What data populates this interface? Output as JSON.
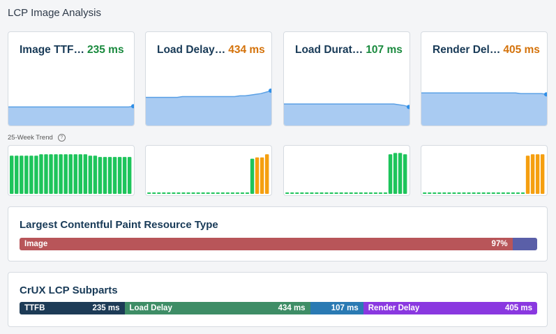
{
  "page": {
    "title": "LCP Image Analysis"
  },
  "metrics": [
    {
      "name": "Image TTF…",
      "value": "235 ms",
      "status": "good",
      "trend": [
        26,
        26,
        26,
        26,
        26,
        26,
        26,
        26,
        26,
        26,
        26,
        26,
        26,
        26,
        26,
        26,
        26,
        26,
        26,
        26,
        26,
        26,
        26,
        26,
        27
      ]
    },
    {
      "name": "Load Delay…",
      "value": "434 ms",
      "status": "ni",
      "trend": [
        39,
        39,
        39,
        39,
        39,
        39,
        39,
        40,
        40,
        40,
        40,
        40,
        40,
        40,
        40,
        40,
        40,
        40,
        41,
        41,
        42,
        43,
        44,
        46,
        48
      ]
    },
    {
      "name": "Load Durat…",
      "value": "107 ms",
      "status": "good",
      "trend": [
        30,
        30,
        30,
        30,
        30,
        30,
        30,
        30,
        30,
        30,
        30,
        30,
        30,
        30,
        30,
        30,
        30,
        30,
        30,
        30,
        30,
        30,
        29,
        28,
        26
      ]
    },
    {
      "name": "Render Del…",
      "value": "405 ms",
      "status": "ni",
      "trend": [
        45,
        45,
        45,
        45,
        45,
        45,
        45,
        45,
        45,
        45,
        45,
        45,
        45,
        45,
        45,
        45,
        45,
        45,
        45,
        44,
        44,
        44,
        44,
        44,
        43
      ]
    }
  ],
  "trend_section": {
    "label": "25-Week Trend",
    "info_icon": "info-circle-icon"
  },
  "weekly_bars": [
    {
      "heights": [
        0.87,
        0.87,
        0.87,
        0.87,
        0.87,
        0.87,
        0.9,
        0.9,
        0.9,
        0.9,
        0.9,
        0.9,
        0.9,
        0.9,
        0.9,
        0.9,
        0.87,
        0.87,
        0.84,
        0.84,
        0.84,
        0.84,
        0.84,
        0.84,
        0.84
      ],
      "colors": [
        "g",
        "g",
        "g",
        "g",
        "g",
        "g",
        "g",
        "g",
        "g",
        "g",
        "g",
        "g",
        "g",
        "g",
        "g",
        "g",
        "g",
        "g",
        "g",
        "g",
        "g",
        "g",
        "g",
        "g",
        "g"
      ]
    },
    {
      "heights": [
        0.03,
        0.03,
        0.03,
        0.03,
        0.03,
        0.03,
        0.03,
        0.03,
        0.03,
        0.03,
        0.03,
        0.03,
        0.03,
        0.03,
        0.03,
        0.03,
        0.03,
        0.03,
        0.03,
        0.03,
        0.03,
        0.8,
        0.83,
        0.83,
        0.9
      ],
      "colors": [
        "g",
        "g",
        "g",
        "g",
        "g",
        "g",
        "g",
        "g",
        "g",
        "g",
        "g",
        "g",
        "g",
        "g",
        "g",
        "g",
        "g",
        "g",
        "g",
        "g",
        "g",
        "g",
        "o",
        "o",
        "o"
      ]
    },
    {
      "heights": [
        0.03,
        0.03,
        0.03,
        0.03,
        0.03,
        0.03,
        0.03,
        0.03,
        0.03,
        0.03,
        0.03,
        0.03,
        0.03,
        0.03,
        0.03,
        0.03,
        0.03,
        0.03,
        0.03,
        0.03,
        0.03,
        0.9,
        0.93,
        0.93,
        0.9
      ],
      "colors": [
        "g",
        "g",
        "g",
        "g",
        "g",
        "g",
        "g",
        "g",
        "g",
        "g",
        "g",
        "g",
        "g",
        "g",
        "g",
        "g",
        "g",
        "g",
        "g",
        "g",
        "g",
        "g",
        "g",
        "g",
        "g"
      ]
    },
    {
      "heights": [
        0.03,
        0.03,
        0.03,
        0.03,
        0.03,
        0.03,
        0.03,
        0.03,
        0.03,
        0.03,
        0.03,
        0.03,
        0.03,
        0.03,
        0.03,
        0.03,
        0.03,
        0.03,
        0.03,
        0.03,
        0.03,
        0.87,
        0.9,
        0.9,
        0.9
      ],
      "colors": [
        "g",
        "g",
        "g",
        "g",
        "g",
        "g",
        "g",
        "g",
        "g",
        "g",
        "g",
        "g",
        "g",
        "g",
        "g",
        "g",
        "g",
        "g",
        "g",
        "g",
        "g",
        "o",
        "o",
        "o",
        "o"
      ]
    }
  ],
  "resource_type": {
    "title": "Largest Contentful Paint Resource Type",
    "segments": [
      {
        "label": "Image",
        "value": "97%",
        "share": 97,
        "color": "#b85559"
      },
      {
        "label": "",
        "value": "",
        "share": 3,
        "color": "#5a5fa8"
      }
    ]
  },
  "subparts": {
    "title": "CrUX LCP Subparts",
    "segments": [
      {
        "label": "TTFB",
        "value": "235 ms",
        "ms": 235,
        "color": "#1d3b56"
      },
      {
        "label": "Load Delay",
        "value": "434 ms",
        "ms": 434,
        "color": "#3e8d66"
      },
      {
        "label": "",
        "value": "107 ms",
        "ms": 107,
        "color": "#2a7ab3"
      },
      {
        "label": "Render Delay",
        "value": "405 ms",
        "ms": 405,
        "color": "#8a38e0"
      }
    ]
  },
  "colors": {
    "good": "#1dc45b",
    "ni": "#f59f0f",
    "area_fill": "#a9cbf2",
    "area_line": "#5aa0e5"
  }
}
